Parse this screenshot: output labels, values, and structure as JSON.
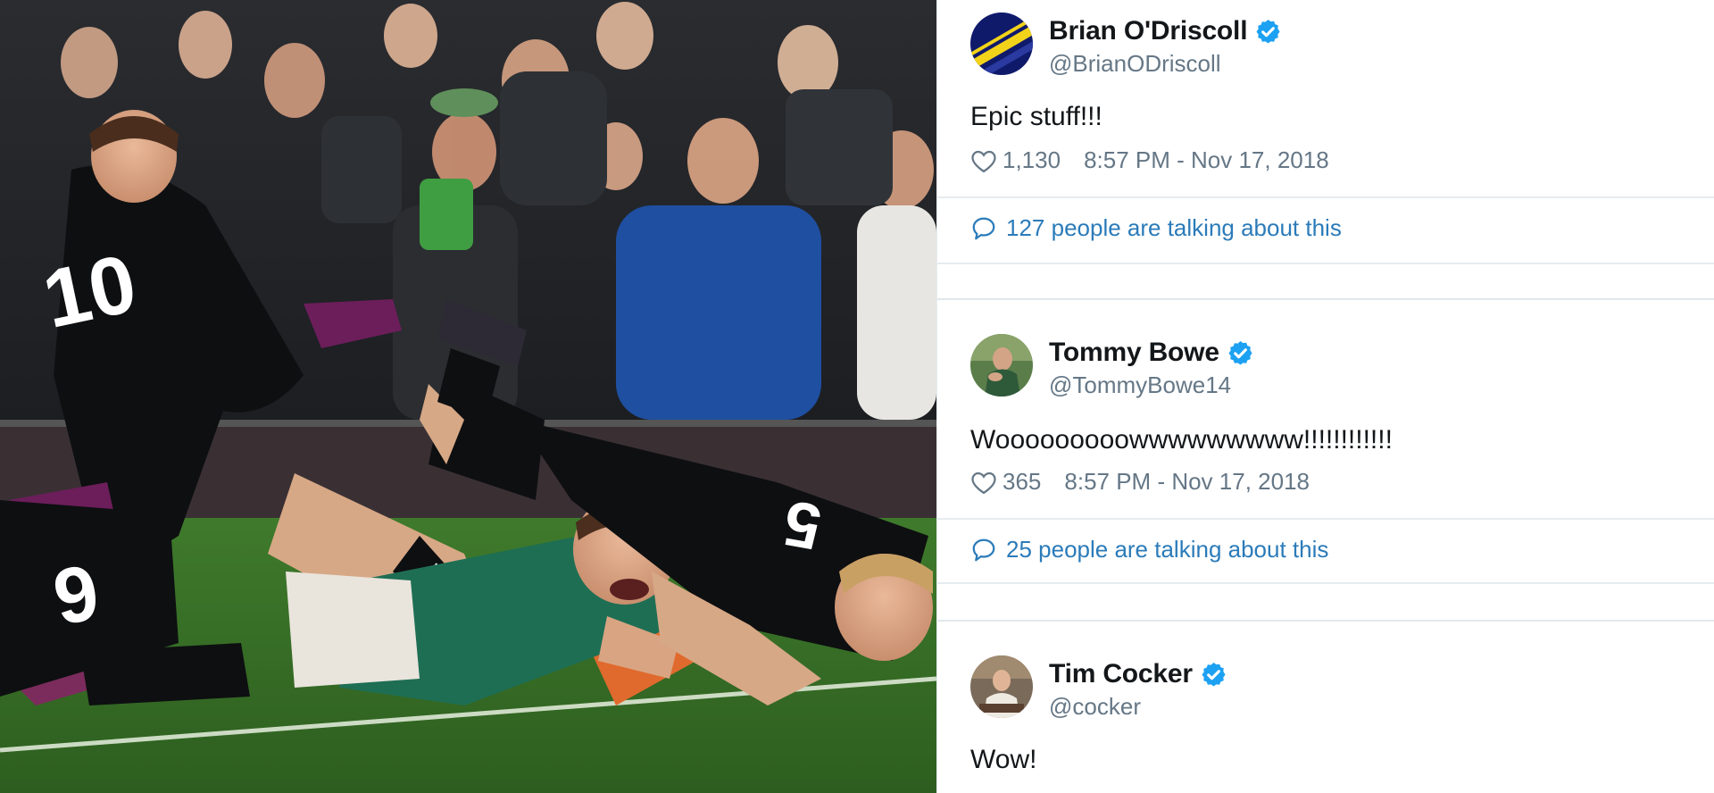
{
  "photo": {
    "description_icon": "rugby-try-photo"
  },
  "tweets": [
    {
      "display_name": "Brian O'Driscoll",
      "handle": "@BrianODriscoll",
      "verified": true,
      "text": "Epic stuff!!!",
      "likes": "1,130",
      "timestamp": "8:57 PM - Nov 17, 2018",
      "talking": "127 people are talking about this",
      "avatar_colors": [
        "#1a2a8a",
        "#f2d31a"
      ]
    },
    {
      "display_name": "Tommy Bowe",
      "handle": "@TommyBowe14",
      "verified": true,
      "text": "Wooooooooowwwwwwwww!!!!!!!!!!!!",
      "likes": "365",
      "timestamp": "8:57 PM - Nov 17, 2018",
      "talking": "25 people are talking about this",
      "avatar_colors": [
        "#3d6b3a",
        "#c9a888"
      ]
    },
    {
      "display_name": "Tim Cocker",
      "handle": "@cocker",
      "verified": true,
      "text": "Wow!",
      "avatar_colors": [
        "#6b4a3a",
        "#e8e2d8"
      ]
    }
  ],
  "colors": {
    "verified_blue": "#1da1f2",
    "link_blue": "#2b7bb9",
    "muted_gray": "#657786",
    "text_black": "#14171a",
    "divider": "#e6ecf0"
  }
}
